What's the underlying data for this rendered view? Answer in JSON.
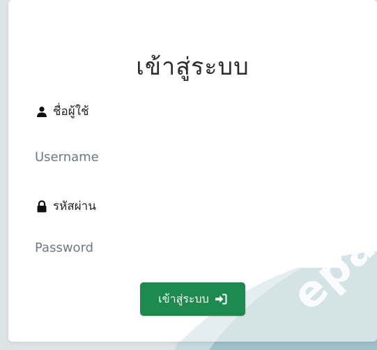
{
  "login": {
    "title": "เข้าสู่ระบบ",
    "username_label": "ชื่อผู้ใช้",
    "username_placeholder": "Username",
    "username_value": "",
    "password_label": "รหัสผ่าน",
    "password_placeholder": "Password",
    "password_value": "",
    "submit_label": "เข้าสู่ระบบ"
  },
  "watermark": {
    "text": "epa"
  },
  "icons": {
    "user": "user-icon",
    "lock": "lock-icon",
    "sign_in": "sign-in-icon"
  },
  "colors": {
    "button": "#1d8a4e",
    "background_light": "#dde4e6",
    "swoosh_light": "#c4dade",
    "swoosh_dark": "#9fc0c8",
    "text": "#222222"
  }
}
